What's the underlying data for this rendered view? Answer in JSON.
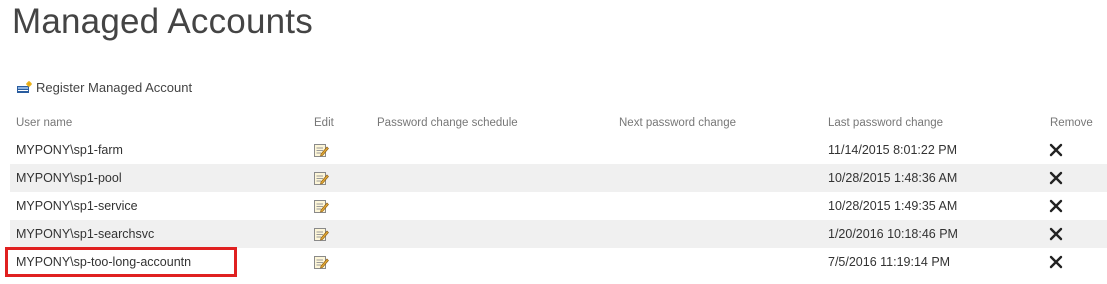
{
  "page": {
    "title": "Managed Accounts"
  },
  "toolbar": {
    "register_label": "Register Managed Account",
    "register_icon": "register-account-icon"
  },
  "table": {
    "columns": {
      "user_name": "User name",
      "edit": "Edit",
      "schedule": "Password change schedule",
      "next_change": "Next password change",
      "last_change": "Last password change",
      "remove": "Remove"
    },
    "rows": [
      {
        "user": "MYPONY\\sp1-farm",
        "schedule": "",
        "next_change": "",
        "last_change": "11/14/2015 8:01:22 PM"
      },
      {
        "user": "MYPONY\\sp1-pool",
        "schedule": "",
        "next_change": "",
        "last_change": "10/28/2015 1:48:36 AM"
      },
      {
        "user": "MYPONY\\sp1-service",
        "schedule": "",
        "next_change": "",
        "last_change": "10/28/2015 1:49:35 AM"
      },
      {
        "user": "MYPONY\\sp1-searchsvc",
        "schedule": "",
        "next_change": "",
        "last_change": "1/20/2016 10:18:46 PM"
      },
      {
        "user": "MYPONY\\sp-too-long-accountn",
        "schedule": "",
        "next_change": "",
        "last_change": "7/5/2016 11:19:14 PM"
      }
    ]
  },
  "annotation": {
    "highlight_color": "#e02020"
  },
  "colors": {
    "text": "#444444",
    "header": "#777777",
    "alt_row": "#f0f0f0"
  }
}
